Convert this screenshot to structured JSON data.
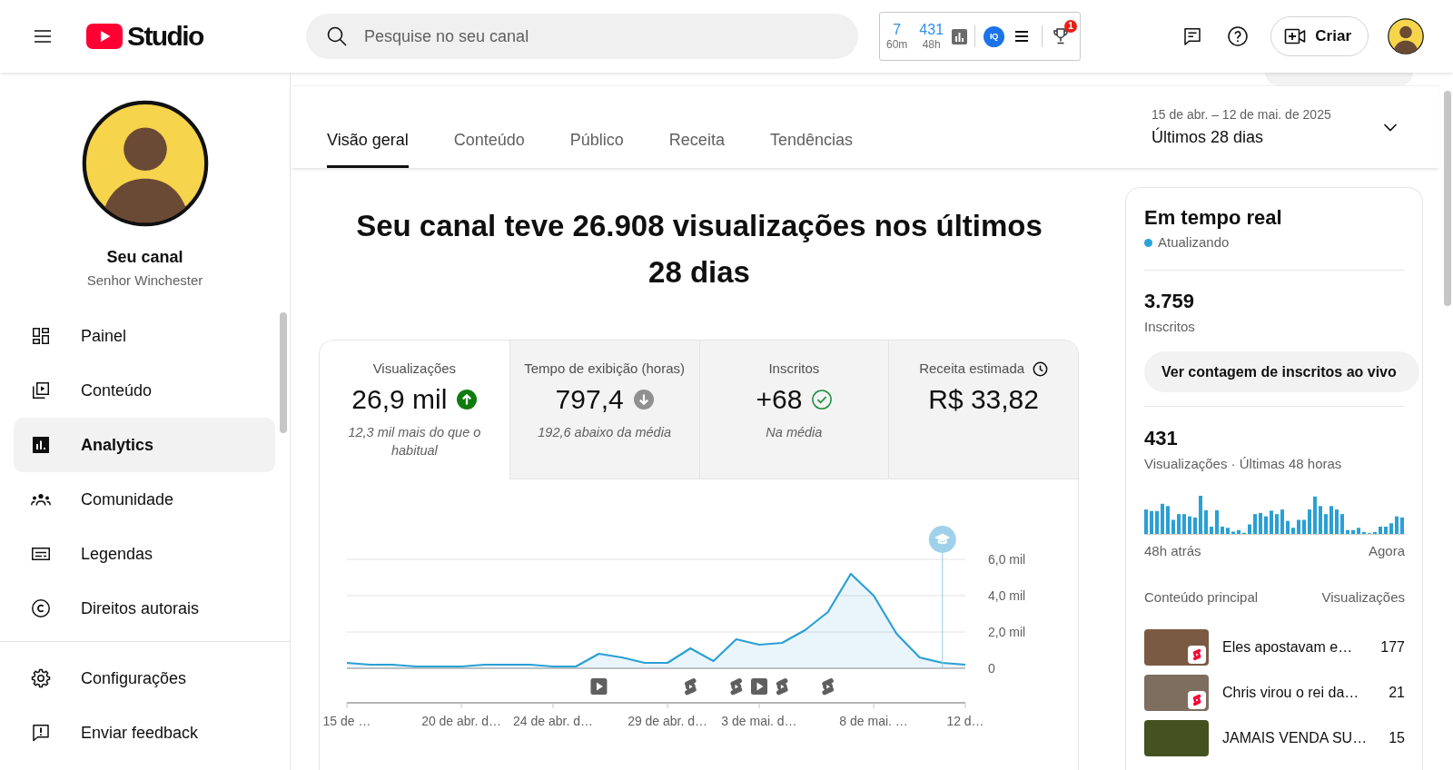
{
  "topbar": {
    "logo": "Studio",
    "search": {
      "placeholder": "Pesquise no seu canal"
    },
    "extension": {
      "stats": [
        {
          "value": "7",
          "period": "60m"
        },
        {
          "value": "431",
          "period": "48h"
        }
      ],
      "logo": "IQ",
      "badge": "1"
    },
    "create_button": "Criar"
  },
  "sidebar": {
    "channel_title": "Seu canal",
    "channel_name": "Senhor Winchester",
    "items": [
      {
        "kind": "dashboard",
        "label": "Painel",
        "selected": false
      },
      {
        "kind": "content",
        "label": "Conteúdo",
        "selected": false
      },
      {
        "kind": "analytics",
        "label": "Analytics",
        "selected": true
      },
      {
        "kind": "community",
        "label": "Comunidade",
        "selected": false
      },
      {
        "kind": "subtitles",
        "label": "Legendas",
        "selected": false
      },
      {
        "kind": "copyright",
        "label": "Direitos autorais",
        "selected": false
      }
    ],
    "footer_items": [
      {
        "kind": "settings",
        "label": "Configurações",
        "selected": false
      },
      {
        "kind": "feedback",
        "label": "Enviar feedback",
        "selected": false
      }
    ]
  },
  "tabs": [
    {
      "label": "Visão geral",
      "selected": true
    },
    {
      "label": "Conteúdo",
      "selected": false
    },
    {
      "label": "Público",
      "selected": false
    },
    {
      "label": "Receita",
      "selected": false
    },
    {
      "label": "Tendências",
      "selected": false
    }
  ],
  "date_range": {
    "range": "15 de abr. – 12 de mai. de 2025",
    "period": "Últimos 28 dias"
  },
  "headline": "Seu canal teve 26.908 visualizações nos últimos 28 dias",
  "overview": {
    "metrics": [
      {
        "label": "Visualizações",
        "value": "26,9 mil",
        "kind": "above",
        "note": "12,3 mil mais do que o habitual",
        "selected": true
      },
      {
        "label": "Tempo de exibição (horas)",
        "value": "797,4",
        "kind": "below",
        "note": "192,6 abaixo da média",
        "selected": false
      },
      {
        "label": "Inscritos",
        "value": "+68",
        "kind": "average",
        "note": "Na média",
        "selected": false
      },
      {
        "label": "Receita estimada",
        "value": "R$ 33,82",
        "kind": "estimated",
        "selected": false
      }
    ],
    "chart_data": {
      "type": "area",
      "categories": [
        "15 de …",
        null,
        null,
        null,
        null,
        "20 de abr. d…",
        null,
        null,
        null,
        "24 de abr. d…",
        null,
        null,
        null,
        null,
        "29 de abr. d…",
        null,
        null,
        null,
        "3 de mai. d…",
        null,
        null,
        null,
        null,
        "8 de mai. …",
        null,
        null,
        null,
        "12 d…"
      ],
      "values": [
        0.3,
        0.2,
        0.2,
        0.1,
        0.1,
        0.1,
        0.2,
        0.2,
        0.2,
        0.1,
        0.1,
        0.8,
        0.6,
        0.3,
        0.3,
        1.1,
        0.4,
        1.6,
        1.3,
        1.4,
        2.1,
        3.1,
        5.2,
        4.0,
        1.9,
        0.6,
        0.3,
        0.2
      ],
      "ylim": [
        0,
        6
      ],
      "yticks": [
        0,
        {
          "value": 2,
          "label": "2,0 mil"
        },
        {
          "value": 4,
          "label": "4,0 mil"
        },
        {
          "value": 6,
          "label": "6,0 mil"
        }
      ]
    },
    "upload_markers": [
      {
        "kind": "video"
      },
      {
        "kind": "short"
      },
      {
        "kind": "short"
      },
      {
        "kind": "video"
      },
      {
        "kind": "short"
      },
      {
        "kind": "short"
      },
      {
        "kind": "milestone"
      }
    ]
  },
  "realtime": {
    "title": "Em tempo real",
    "status": "Atualizando",
    "subscribers": {
      "value": "3.759",
      "label": "Inscritos"
    },
    "live_button": "Ver contagem de inscritos ao vivo",
    "views": {
      "value": "431",
      "label": "Visualizações · Últimas 48 horas"
    },
    "range_start": "48h atrás",
    "range_end": "Agora",
    "top_content": {
      "columns": [
        "Conteúdo principal",
        "Visualizações"
      ],
      "rows": [
        {
          "title": "Eles apostavam e…",
          "views": "177",
          "short": true
        },
        {
          "title": "Chris virou o rei da…",
          "views": "21",
          "short": true
        },
        {
          "title": "JAMAIS VENDA SU…",
          "views": "15",
          "short": false
        }
      ]
    }
  }
}
